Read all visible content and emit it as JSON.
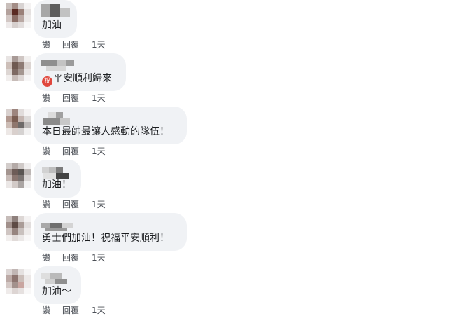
{
  "actions": {
    "like_label": "讚",
    "reply_label": "回覆"
  },
  "comments": [
    {
      "text": "加油",
      "time": "1天",
      "emoji": null
    },
    {
      "text": "平安順利歸來",
      "time": "1天",
      "emoji": "祝"
    },
    {
      "text": "本日最帥最讓人感動的隊伍！",
      "time": "1天",
      "emoji": null
    },
    {
      "text": "加油！",
      "time": "1天",
      "emoji": null
    },
    {
      "text": "勇士們加油！祝福平安順利！",
      "time": "1天",
      "emoji": null
    },
    {
      "text": "加油～",
      "time": "1天",
      "emoji": null
    }
  ]
}
